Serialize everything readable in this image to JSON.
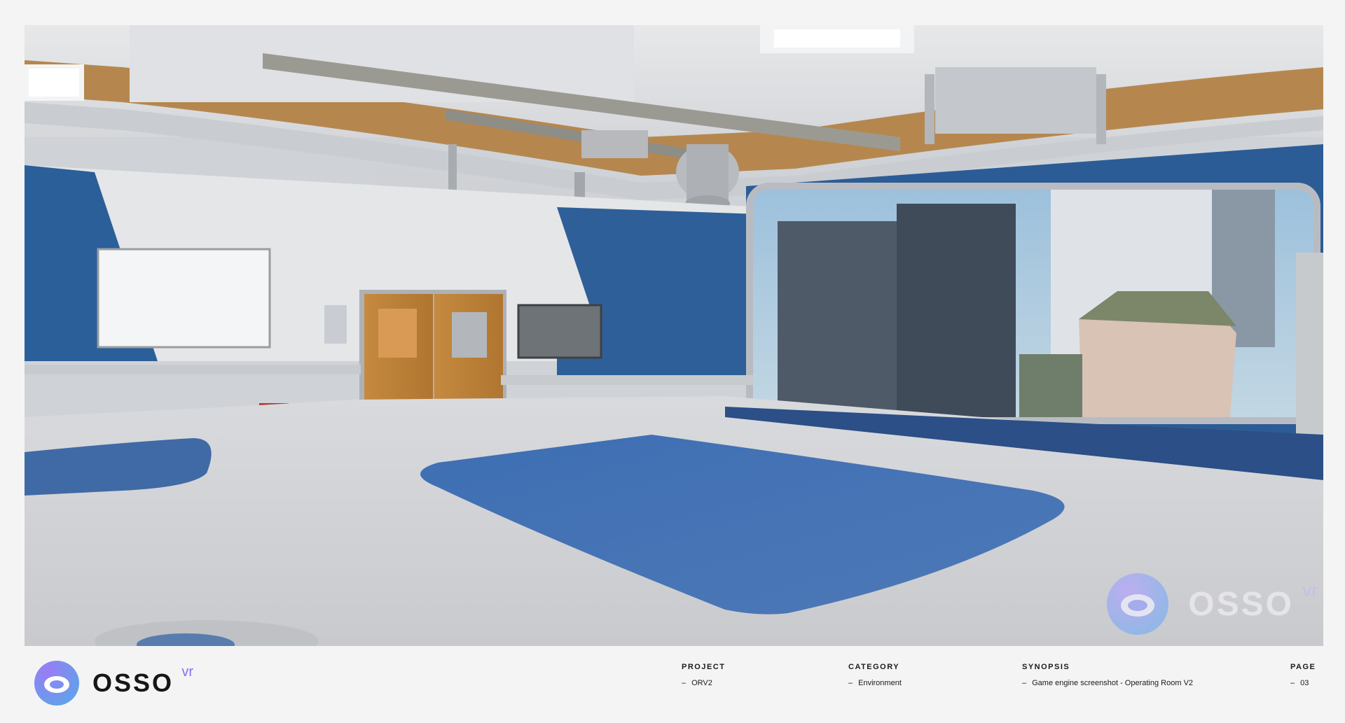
{
  "brand": {
    "logo_text": "OSSO",
    "logo_superscript": "vr",
    "accent_colors": [
      "#8b6bf2",
      "#4fa6e6"
    ]
  },
  "scene": {
    "description_icon": "operating-room-render",
    "watermark_text": "OSSO",
    "watermark_superscript": "vr"
  },
  "footer": {
    "project": {
      "label": "PROJECT",
      "dash": "–",
      "value": "ORV2"
    },
    "category": {
      "label": "CATEGORY",
      "dash": "–",
      "value": "Environment"
    },
    "synopsis": {
      "label": "SYNOPSIS",
      "dash": "–",
      "value": "Game engine screenshot - Operating Room V2"
    },
    "page": {
      "label": "PAGE",
      "dash": "–",
      "value": "03"
    }
  }
}
